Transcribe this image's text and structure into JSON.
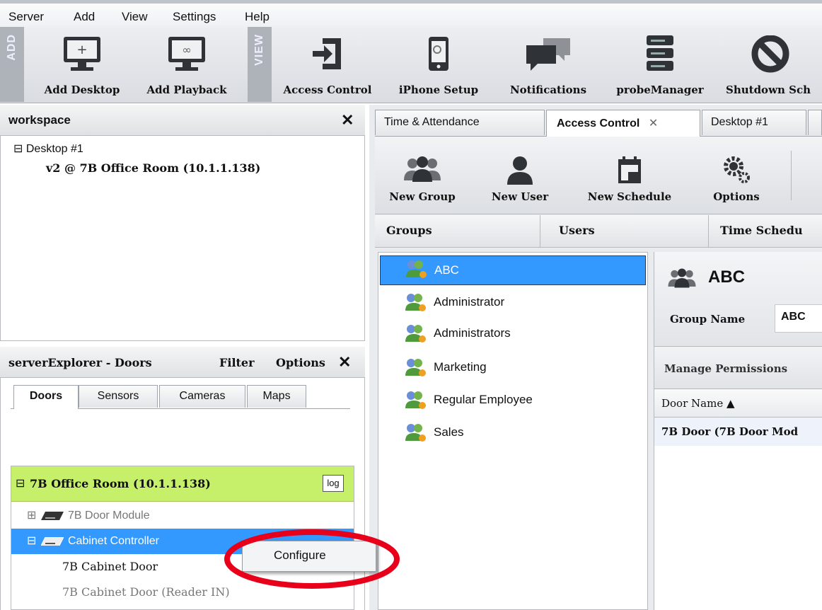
{
  "menu": [
    "Server",
    "Add",
    "View",
    "Settings",
    "Help"
  ],
  "toolbar": {
    "add_tag": "ADD",
    "view_tag": "VIEW",
    "buttons": [
      {
        "label": "Add Desktop",
        "icon": "monitor-plus-icon"
      },
      {
        "label": "Add Playback",
        "icon": "monitor-playback-icon"
      },
      {
        "label": "Access Control",
        "icon": "door-enter-icon"
      },
      {
        "label": "iPhone Setup",
        "icon": "phone-icon"
      },
      {
        "label": "Notifications",
        "icon": "chat-bubbles-icon"
      },
      {
        "label": "probeManager",
        "icon": "server-stack-icon"
      },
      {
        "label": "Shutdown Sch",
        "icon": "no-entry-icon"
      }
    ]
  },
  "workspace": {
    "title": "workspace",
    "close": "✕",
    "tree_root": "Desktop #1",
    "tree_child": "v2 @ 7B Office Room (10.1.1.138)",
    "collapse_symbol": "⊟"
  },
  "server_explorer": {
    "title": "serverExplorer - Doors",
    "filter": "Filter",
    "options": "Options",
    "close": "✕",
    "tabs": [
      "Doors",
      "Sensors",
      "Cameras",
      "Maps"
    ],
    "root_node": "7B Office Room (10.1.1.138)",
    "log_button": "log",
    "rows": [
      {
        "label": "7B Door Module",
        "expander": "⊞"
      },
      {
        "label": "Cabinet Controller",
        "expander": "⊟"
      },
      {
        "label": "7B Cabinet Door"
      },
      {
        "label": "7B Cabinet Door (Reader IN)"
      }
    ],
    "context_menu_item": "Configure"
  },
  "main_tabs": [
    {
      "label": "Time & Attendance"
    },
    {
      "label": "Access Control",
      "close": "✕"
    },
    {
      "label": "Desktop #1"
    }
  ],
  "ac_toolbar": [
    "New Group",
    "New User",
    "New Schedule",
    "Options"
  ],
  "subtabs": [
    "Groups",
    "Users",
    "Time Schedu"
  ],
  "groups": [
    "ABC",
    "Administrator",
    "Administrators",
    "Marketing",
    "Regular Employee",
    "Sales"
  ],
  "detail": {
    "title": "ABC",
    "group_name_label": "Group Name",
    "group_name_value": "ABC",
    "manage_permissions": "Manage Permissions",
    "column_header": "Door Name",
    "sort_arrow": "▲",
    "row": "7B Door (7B Door Mod"
  },
  "colors": {
    "selection": "#3399ff",
    "root_node_bg": "#c7f06a",
    "annotation_red": "#e8001a"
  }
}
